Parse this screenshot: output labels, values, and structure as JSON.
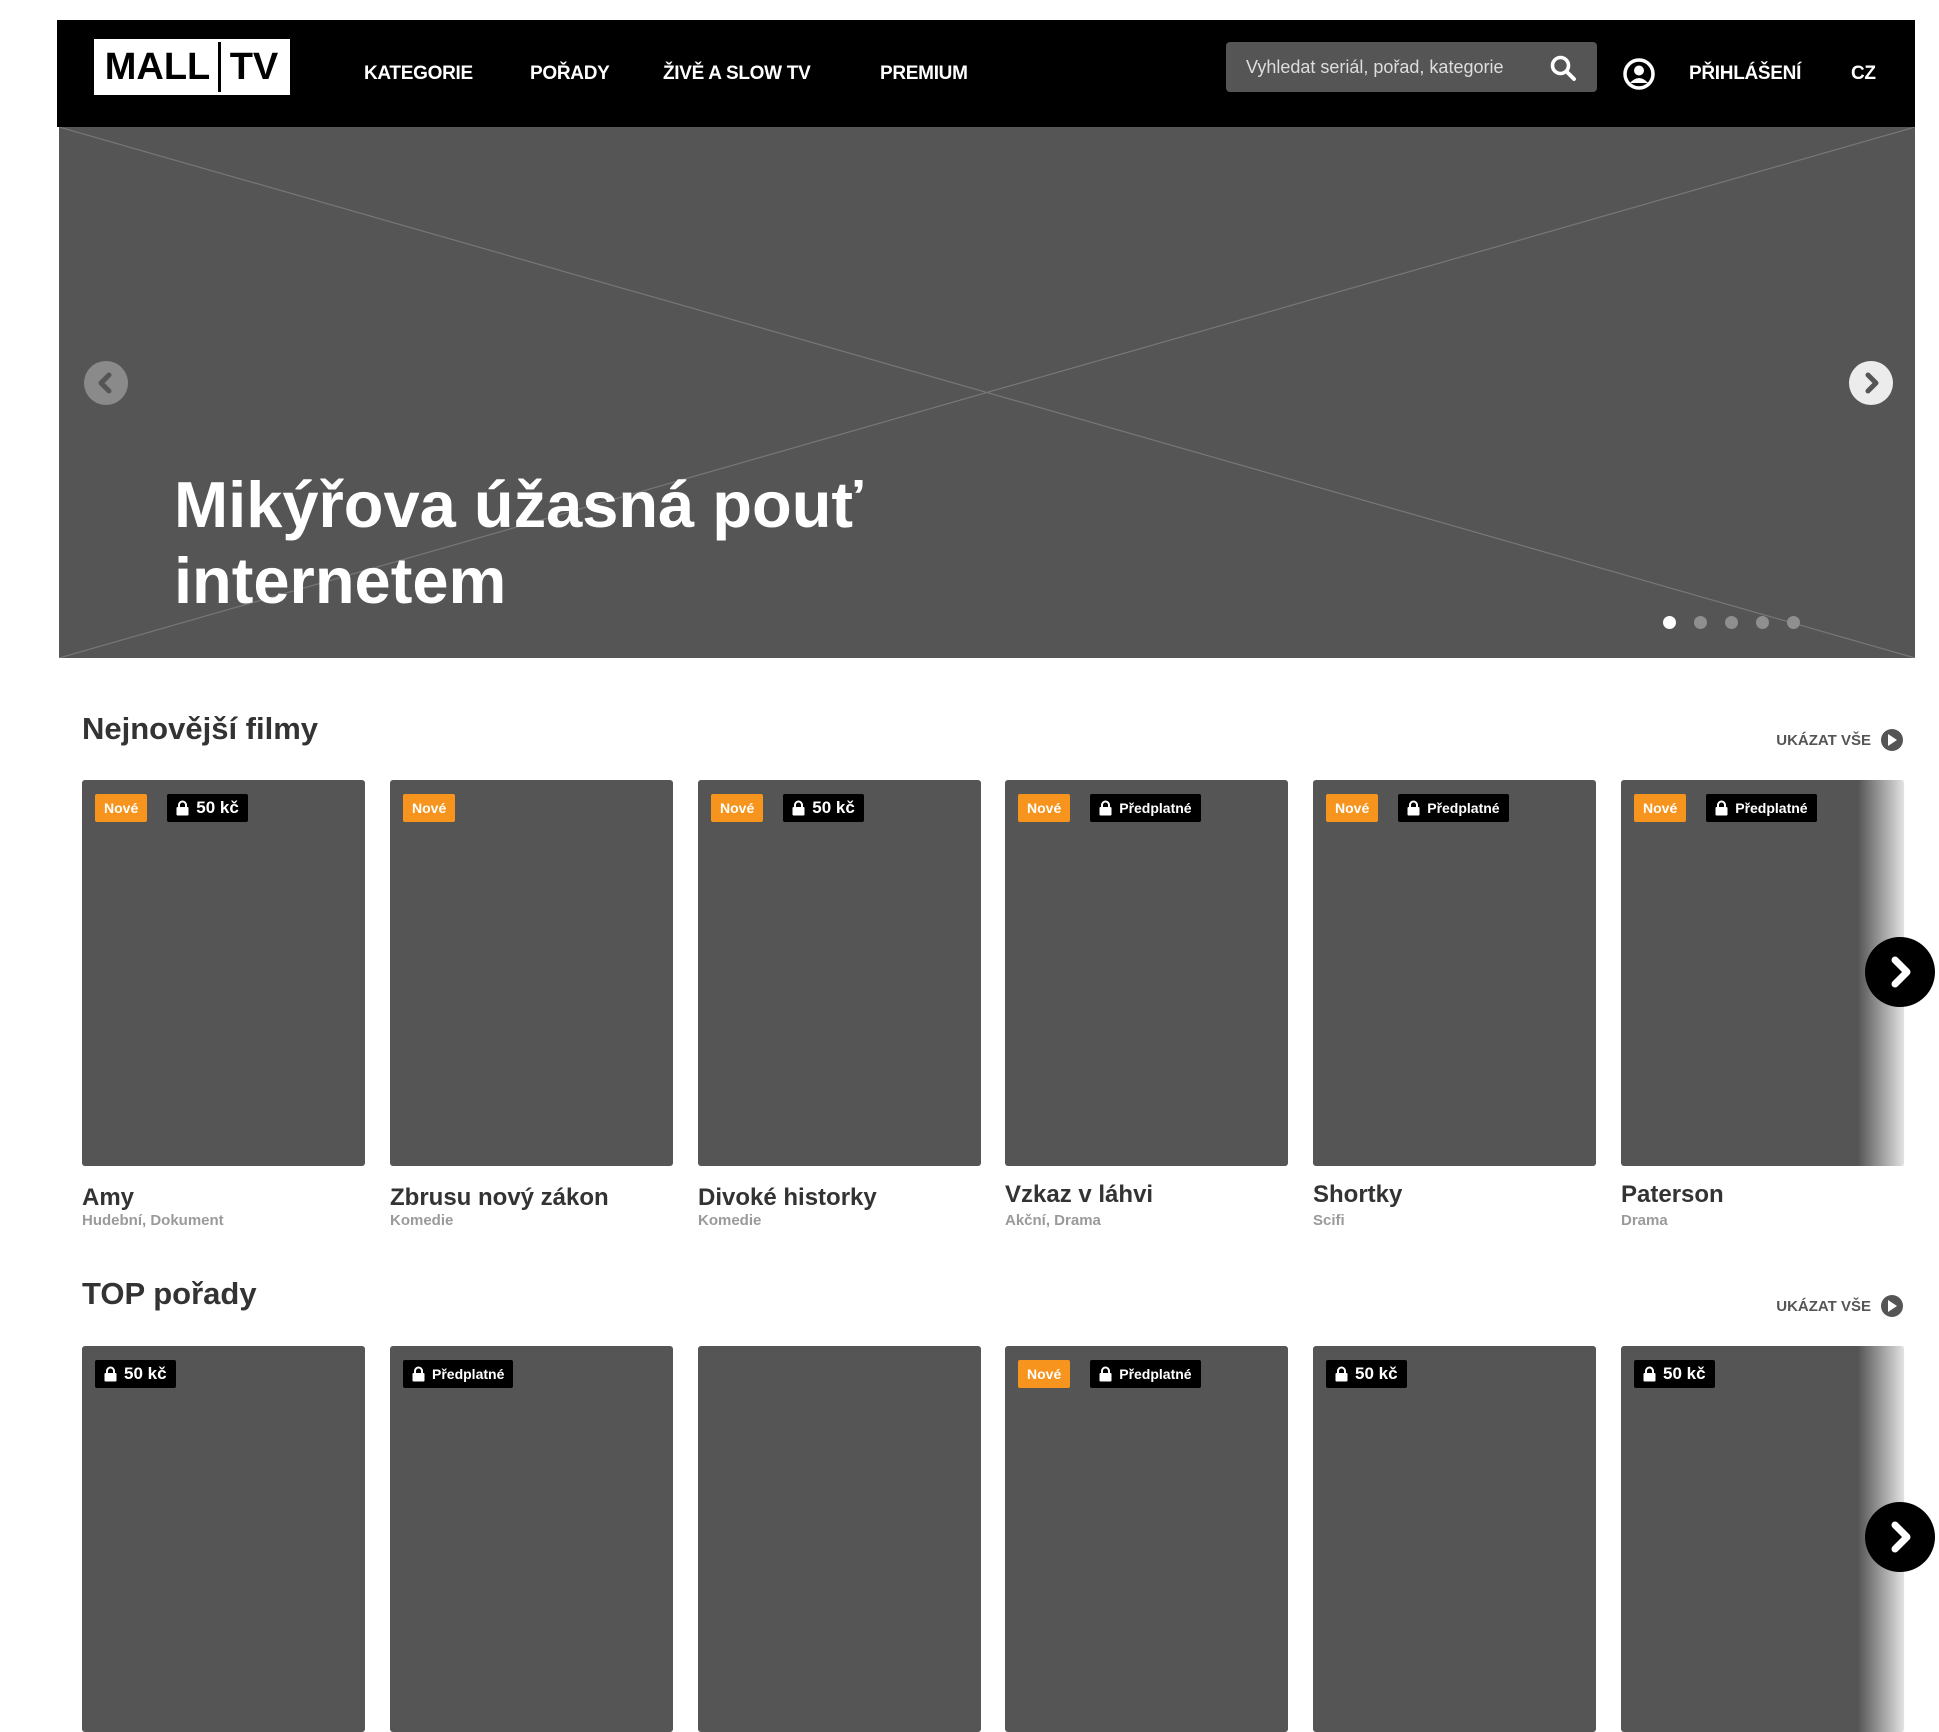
{
  "header": {
    "logo_left": "MALL",
    "logo_right": "TV",
    "nav": [
      "KATEGORIE",
      "POŘADY",
      "ŽIVĚ A SLOW TV",
      "PREMIUM"
    ],
    "search_placeholder": "Vyhledat seriál, pořad, kategorie",
    "login_label": "PŘIHLÁŠENÍ",
    "language": "CZ"
  },
  "hero": {
    "title": "Mikýřova úžasná pouť internetem",
    "slides_total": 5,
    "active_slide": 1
  },
  "sections": [
    {
      "title": "Nejnovější filmy",
      "show_all": "UKÁZAT VŠE",
      "items": [
        {
          "title": "Amy",
          "genre": "Hudební, Dokument",
          "new": "Nové",
          "price": "50 kč"
        },
        {
          "title": "Zbrusu nový zákon",
          "genre": "Komedie",
          "new": "Nové",
          "price": ""
        },
        {
          "title": "Divoké historky",
          "genre": "Komedie",
          "new": "Nové",
          "price": "50 kč"
        },
        {
          "title": "Vzkaz v láhvi",
          "genre": "Akční, Drama",
          "new": "Nové",
          "price": "Předplatné"
        },
        {
          "title": "Shortky",
          "genre": "Scifi",
          "new": "Nové",
          "price": "Předplatné"
        },
        {
          "title": "Paterson",
          "genre": "Drama",
          "new": "Nové",
          "price": "Předplatné"
        }
      ]
    },
    {
      "title": "TOP pořady",
      "show_all": "UKÁZAT VŠE",
      "items": [
        {
          "new": "",
          "price": "50 kč"
        },
        {
          "new": "",
          "price": "Předplatné"
        },
        {
          "new": "",
          "price": ""
        },
        {
          "new": "Nové",
          "price": "Předplatné"
        },
        {
          "new": "",
          "price": "50 kč"
        },
        {
          "new": "",
          "price": "50 kč"
        }
      ]
    }
  ],
  "colors": {
    "header_bg": "#000000",
    "placeholder_gray": "#555555",
    "badge_new": "#f7941d",
    "badge_lock": "#000000"
  },
  "icons": [
    "search-icon",
    "user-icon",
    "chevron-left-icon",
    "chevron-right-icon",
    "lock-icon",
    "play-circle-icon"
  ]
}
